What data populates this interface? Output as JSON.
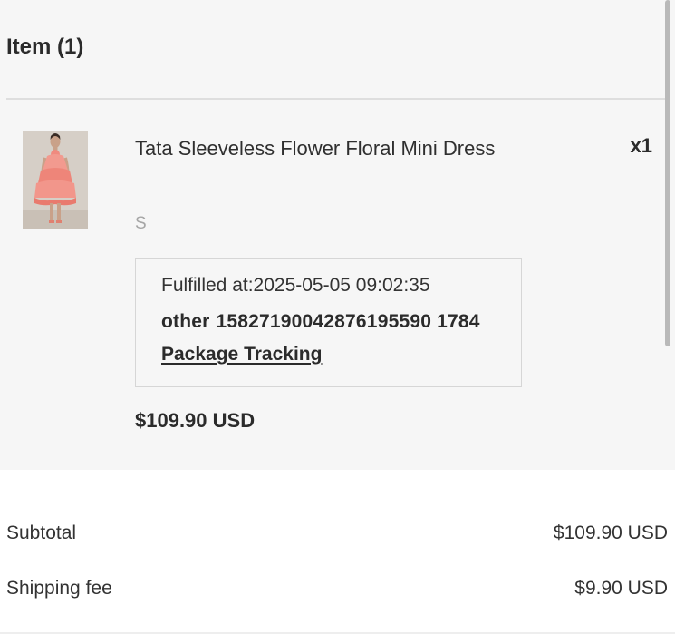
{
  "items_section": {
    "title": "Item (1)"
  },
  "item": {
    "image_alt": "model-wearing-coral-ruffle-dress",
    "name": "Tata Sleeveless Flower Floral Mini Dress",
    "quantity": "x1",
    "variant": "S",
    "fulfillment": {
      "fulfilled_at": "Fulfilled at:2025-05-05 09:02:35",
      "carrier": "other",
      "tracking_number": "15827190042876195590 1784",
      "tracking_link_label": "Package Tracking"
    },
    "price": "$109.90 USD"
  },
  "summary": {
    "subtotal_label": "Subtotal",
    "subtotal_value": "$109.90 USD",
    "shipping_label": "Shipping fee",
    "shipping_value": "$9.90 USD"
  },
  "colors": {
    "panel_bg": "#f6f6f6",
    "text": "#2b2b2b",
    "muted": "#a6a6a6",
    "dress": "#f08a7f"
  }
}
